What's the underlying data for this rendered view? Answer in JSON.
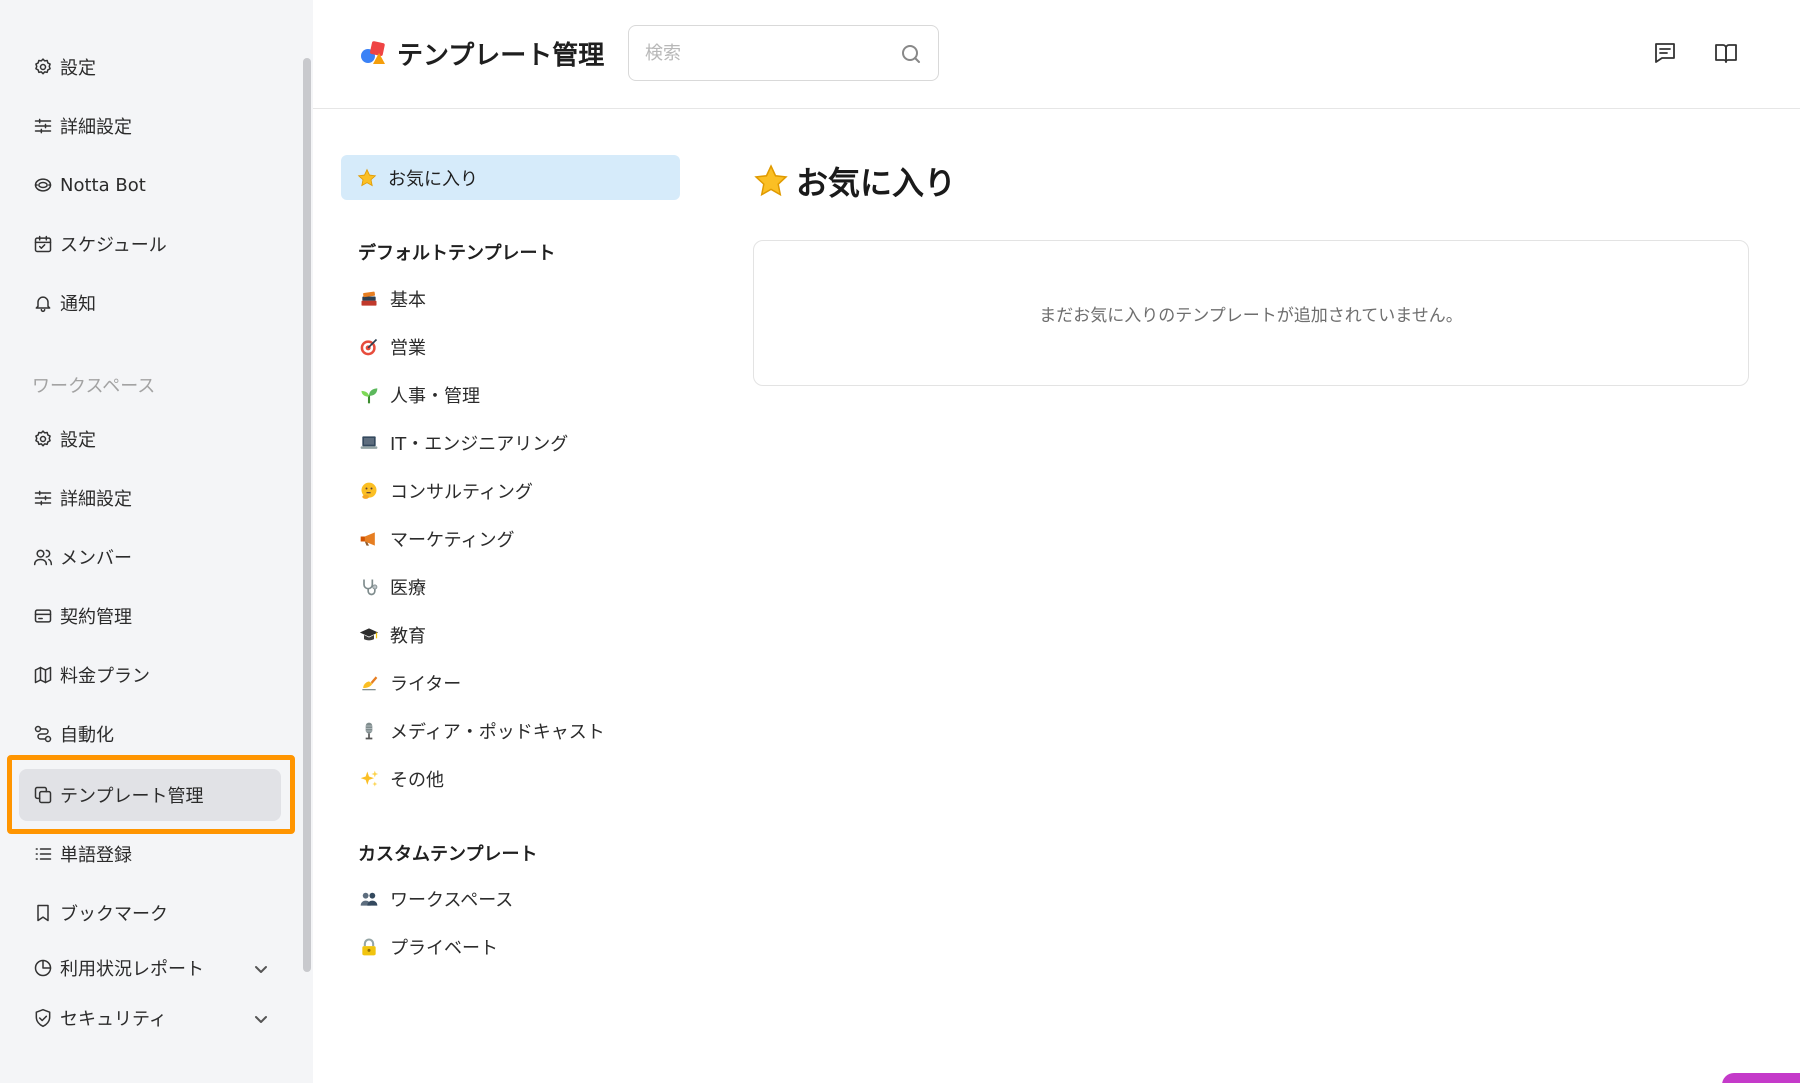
{
  "sidebar": {
    "personal_items": [
      {
        "label": "設定",
        "icon": "gear-icon"
      },
      {
        "label": "詳細設定",
        "icon": "sliders-icon"
      },
      {
        "label": "Notta Bot",
        "icon": "bot-icon"
      },
      {
        "label": "スケジュール",
        "icon": "calendar-icon"
      },
      {
        "label": "通知",
        "icon": "bell-icon"
      }
    ],
    "workspace_section_label": "ワークスペース",
    "workspace_items": [
      {
        "label": "設定",
        "icon": "gear-icon"
      },
      {
        "label": "詳細設定",
        "icon": "sliders-icon"
      },
      {
        "label": "メンバー",
        "icon": "members-icon"
      },
      {
        "label": "契約管理",
        "icon": "contract-icon"
      },
      {
        "label": "料金プラン",
        "icon": "map-icon"
      },
      {
        "label": "自動化",
        "icon": "automation-icon"
      },
      {
        "label": "テンプレート管理",
        "icon": "template-icon",
        "active": true
      },
      {
        "label": "単語登録",
        "icon": "list-icon"
      },
      {
        "label": "ブックマーク",
        "icon": "bookmark-icon"
      },
      {
        "label": "利用状況レポート",
        "icon": "pie-chart-icon",
        "expandable": true
      },
      {
        "label": "セキュリティ",
        "icon": "shield-icon",
        "expandable": true
      }
    ]
  },
  "header": {
    "title": "テンプレート管理",
    "search_placeholder": "検索",
    "search_value": ""
  },
  "categories": {
    "favorites_label": "お気に入り",
    "default_heading": "デフォルトテンプレート",
    "default_items": [
      {
        "label": "基本",
        "icon": "books-emoji-icon"
      },
      {
        "label": "営業",
        "icon": "target-emoji-icon"
      },
      {
        "label": "人事・管理",
        "icon": "seedling-emoji-icon"
      },
      {
        "label": "IT・エンジニアリング",
        "icon": "laptop-emoji-icon"
      },
      {
        "label": "コンサルティング",
        "icon": "thinking-emoji-icon"
      },
      {
        "label": "マーケティング",
        "icon": "megaphone-emoji-icon"
      },
      {
        "label": "医療",
        "icon": "stethoscope-emoji-icon"
      },
      {
        "label": "教育",
        "icon": "graduation-cap-emoji-icon"
      },
      {
        "label": "ライター",
        "icon": "writing-hand-emoji-icon"
      },
      {
        "label": "メディア・ポッドキャスト",
        "icon": "microphone-emoji-icon"
      },
      {
        "label": "その他",
        "icon": "sparkles-emoji-icon"
      }
    ],
    "custom_heading": "カスタムテンプレート",
    "custom_items": [
      {
        "label": "ワークスペース",
        "icon": "people-emoji-icon"
      },
      {
        "label": "プライベート",
        "icon": "lock-emoji-icon"
      }
    ]
  },
  "main": {
    "title": "お気に入り",
    "empty_message": "まだお気に入りのテンプレートが追加されていません。"
  },
  "colors": {
    "highlight_border": "#ff9500",
    "favorite_bg": "#d6ebfa",
    "sidebar_bg": "#f4f5f7",
    "active_item_bg": "#e1e2e6"
  }
}
